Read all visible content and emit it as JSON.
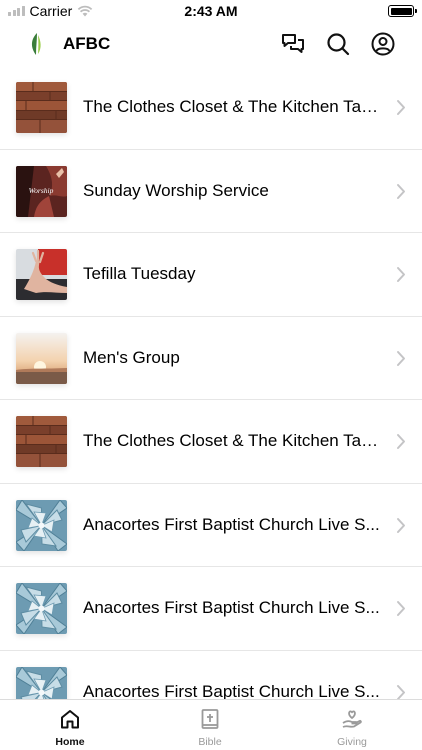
{
  "status_bar": {
    "carrier": "Carrier",
    "time": "2:43 AM"
  },
  "header": {
    "title": "AFBC",
    "accent": "#3a7d3a"
  },
  "list": [
    {
      "title": "The Clothes Closet & The Kitchen Table",
      "thumb": "wood"
    },
    {
      "title": "Sunday Worship Service",
      "thumb": "worship",
      "thumb_text": "Worship"
    },
    {
      "title": "Tefilla Tuesday",
      "thumb": "hands"
    },
    {
      "title": "Men's Group",
      "thumb": "sunset"
    },
    {
      "title": "The Clothes Closet & The Kitchen Table",
      "thumb": "wood"
    },
    {
      "title": "Anacortes First Baptist Church Live S...",
      "thumb": "succulent"
    },
    {
      "title": "Anacortes First Baptist Church Live S...",
      "thumb": "succulent"
    },
    {
      "title": "Anacortes First Baptist Church Live S...",
      "thumb": "succulent"
    }
  ],
  "tabs": [
    {
      "label": "Home",
      "icon": "home-icon",
      "active": true
    },
    {
      "label": "Bible",
      "icon": "bible-icon",
      "active": false
    },
    {
      "label": "Giving",
      "icon": "giving-icon",
      "active": false
    }
  ]
}
